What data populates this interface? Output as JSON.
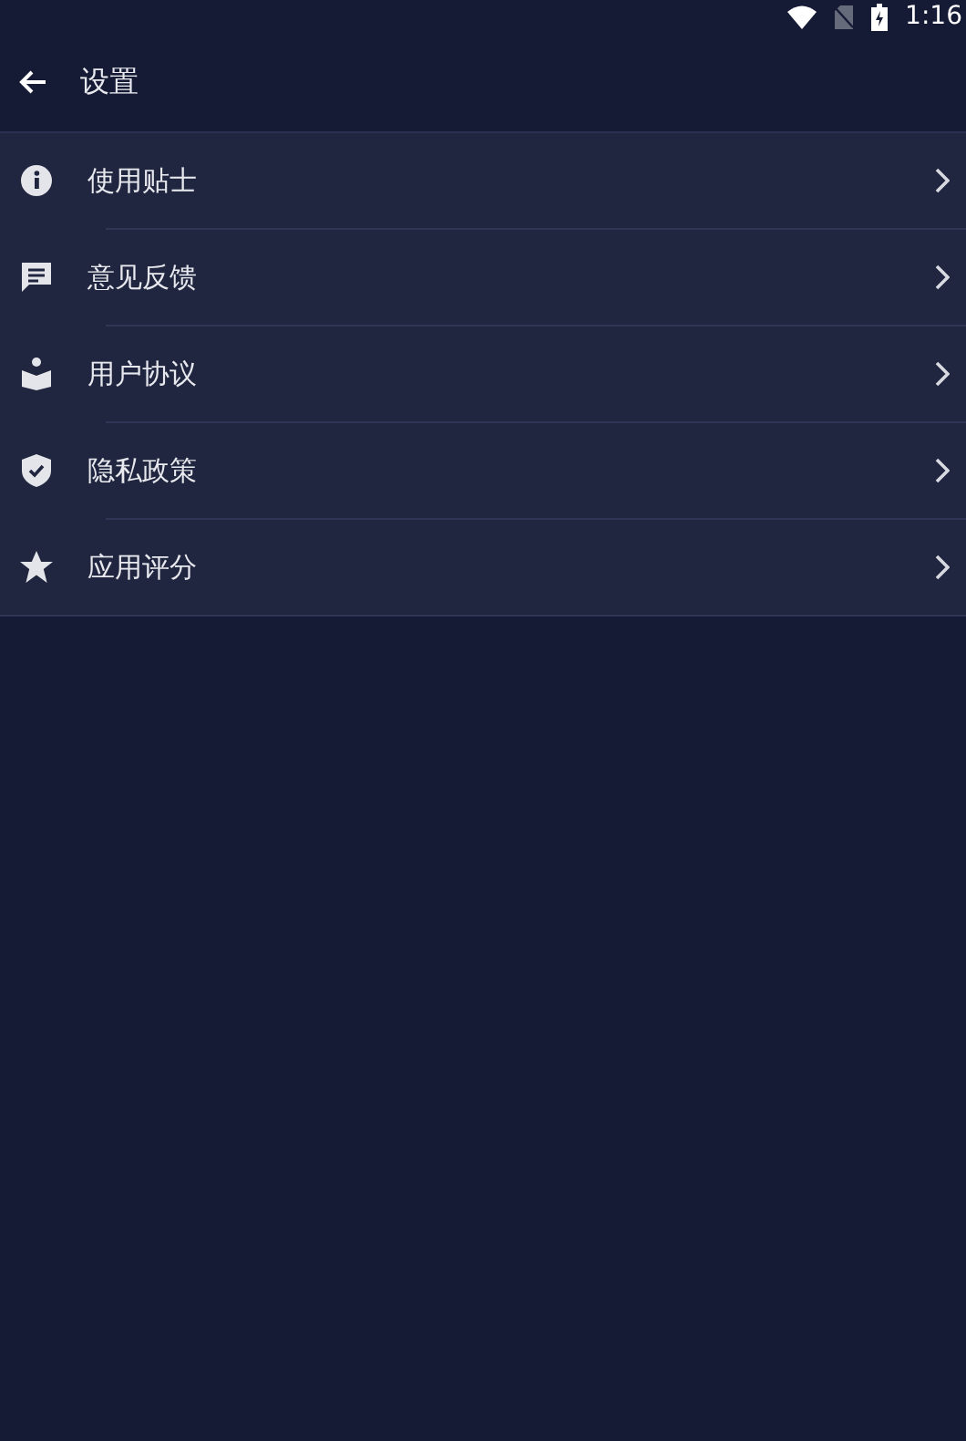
{
  "status_bar": {
    "time": "1:16"
  },
  "toolbar": {
    "title": "设置"
  },
  "menu_items": [
    {
      "label": "使用贴士"
    },
    {
      "label": "意见反馈"
    },
    {
      "label": "用户协议"
    },
    {
      "label": "隐私政策"
    },
    {
      "label": "应用评分"
    }
  ]
}
